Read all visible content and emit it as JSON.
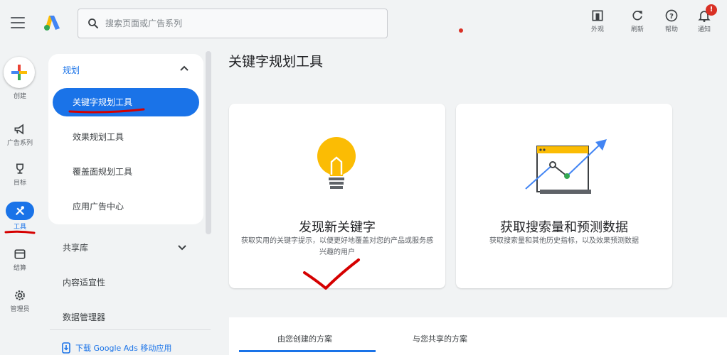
{
  "search": {
    "placeholder": "搜索页面或广告系列"
  },
  "top_actions": [
    {
      "icon": "appearance-icon",
      "label": "外观"
    },
    {
      "icon": "refresh-icon",
      "label": "刷新"
    },
    {
      "icon": "help-icon",
      "label": "帮助"
    },
    {
      "icon": "notifications-icon",
      "label": "通知",
      "badge": "!"
    }
  ],
  "rail": {
    "create": "创建",
    "items": [
      {
        "icon": "megaphone-icon",
        "label": "广告系列"
      },
      {
        "icon": "trophy-icon",
        "label": "目标"
      },
      {
        "icon": "tools-icon",
        "label": "工具",
        "active": true
      },
      {
        "icon": "billing-icon",
        "label": "结算"
      },
      {
        "icon": "gear-icon",
        "label": "管理员"
      }
    ]
  },
  "nav": {
    "section": "规划",
    "items": [
      "关键字规划工具",
      "效果规划工具",
      "覆盖面规划工具",
      "应用广告中心"
    ],
    "other_sections": [
      "共享库",
      "内容适宜性",
      "数据管理器"
    ],
    "download": "下载 Google Ads 移动应用"
  },
  "main": {
    "title": "关键字规划工具",
    "cards": [
      {
        "title": "发现新关键字",
        "desc": "获取实用的关键字提示，以便更好地覆盖对您的产品或服务感兴趣的用户"
      },
      {
        "title": "获取搜索量和预测数据",
        "desc": "获取搜索量和其他历史指标，以及效果预测数据"
      }
    ],
    "tabs": [
      "由您创建的方案",
      "与您共享的方案"
    ]
  },
  "colors": {
    "accent": "#1a73e8",
    "annotation": "#d50000"
  }
}
